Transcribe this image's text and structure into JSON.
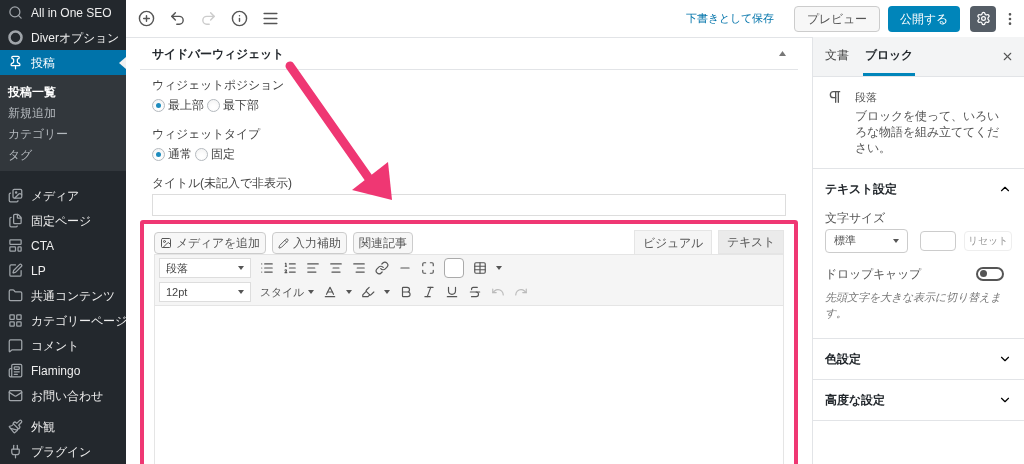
{
  "sidebar": {
    "items": [
      {
        "label": "All in One SEO",
        "selected": false
      },
      {
        "label": "Diverオプション",
        "selected": false
      },
      {
        "label": "投稿",
        "selected": true,
        "children": [
          {
            "label": "投稿一覧",
            "selected": true
          },
          {
            "label": "新規追加",
            "selected": false
          },
          {
            "label": "カテゴリー",
            "selected": false
          },
          {
            "label": "タグ",
            "selected": false
          }
        ]
      },
      {
        "label": "メディア",
        "selected": false
      },
      {
        "label": "固定ページ",
        "selected": false
      },
      {
        "label": "CTA",
        "selected": false
      },
      {
        "label": "LP",
        "selected": false
      },
      {
        "label": "共通コンテンツ",
        "selected": false
      },
      {
        "label": "カテゴリーページ",
        "selected": false
      },
      {
        "label": "コメント",
        "selected": false
      },
      {
        "label": "Flamingo",
        "selected": false
      },
      {
        "label": "お問い合わせ",
        "selected": false
      },
      {
        "label": "外観",
        "selected": false
      },
      {
        "label": "プラグイン",
        "selected": false
      }
    ]
  },
  "toolbar": {
    "tools": [
      {
        "kind": "add",
        "disabled": false
      },
      {
        "kind": "undo",
        "disabled": false
      },
      {
        "kind": "redo",
        "disabled": true
      },
      {
        "kind": "info",
        "disabled": false
      },
      {
        "kind": "outline",
        "disabled": false
      }
    ],
    "save_draft": "下書きとして保存",
    "preview": "プレビュー",
    "publish": "公開する",
    "settings_on": true
  },
  "widget": {
    "title": "サイドバーウィジェット",
    "expanded": true,
    "groups": [
      {
        "label": "ウィジェットポジション",
        "options": [
          {
            "label": "最上部",
            "selected": true
          },
          {
            "label": "最下部",
            "selected": false
          }
        ]
      },
      {
        "label": "ウィジェットタイプ",
        "options": [
          {
            "label": "通常",
            "selected": true
          },
          {
            "label": "固定",
            "selected": false
          }
        ]
      }
    ],
    "title_field_label": "タイトル(未記入で非表示)"
  },
  "editor": {
    "buttons": [
      {
        "kind": "media",
        "label": "メディアを追加"
      },
      {
        "kind": "assist",
        "label": "入力補助"
      },
      {
        "kind": "plain",
        "label": "関連記事"
      }
    ],
    "tabs": [
      {
        "label": "ビジュアル",
        "selected": true
      },
      {
        "label": "テキスト",
        "selected": false
      }
    ],
    "format": "段落",
    "font_size": "12pt",
    "style_menu": "スタイル"
  },
  "panel": {
    "tabs": [
      {
        "label": "文書",
        "selected": false
      },
      {
        "label": "ブロック",
        "selected": true
      }
    ],
    "block": {
      "name": "段落",
      "description": "ブロックを使って、いろいろな物語を組み立ててください。"
    },
    "sections": [
      {
        "title": "テキスト設定",
        "expanded": true
      },
      {
        "title": "色設定",
        "expanded": false
      },
      {
        "title": "高度な設定",
        "expanded": false
      }
    ],
    "font_size_label": "文字サイズ",
    "font_size_value": "標準",
    "reset": {
      "label": "リセット",
      "disabled": true
    },
    "drop_cap": {
      "label": "ドロップキャップ",
      "on": false,
      "help": "先頭文字を大きな表示に切り替えます。"
    }
  }
}
